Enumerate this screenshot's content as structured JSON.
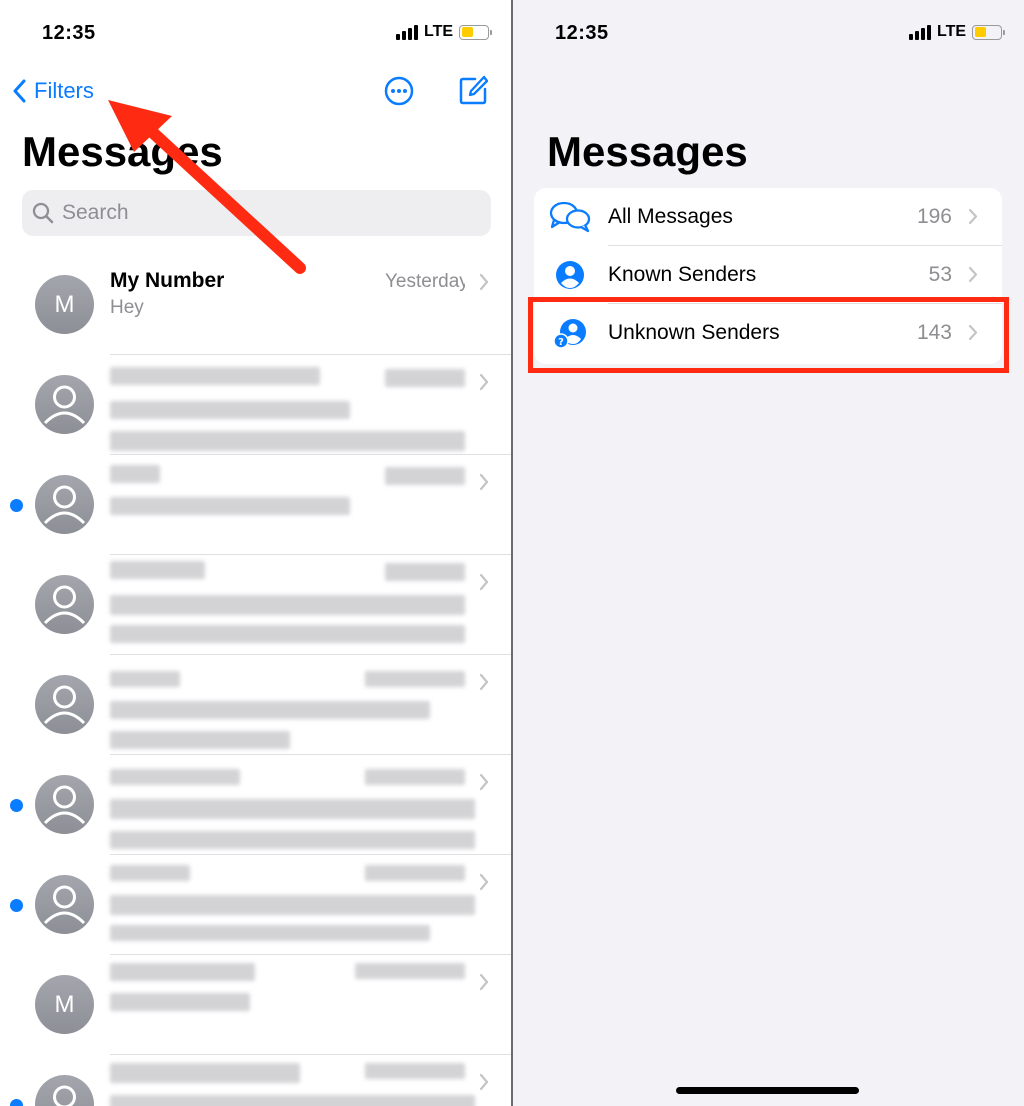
{
  "left": {
    "status": {
      "time": "12:35",
      "network": "LTE"
    },
    "nav": {
      "back_label": "Filters"
    },
    "title": "Messages",
    "search": {
      "placeholder": "Search"
    },
    "messages": [
      {
        "avatar": "M",
        "name": "My Number",
        "preview": "Hey",
        "time": "Yesterday",
        "unread": false
      },
      {
        "avatar": "",
        "name": "",
        "preview": "",
        "time": "",
        "unread": false
      },
      {
        "avatar": "",
        "name": "",
        "preview": "",
        "time": "",
        "unread": true
      },
      {
        "avatar": "",
        "name": "",
        "preview": "",
        "time": "",
        "unread": false
      },
      {
        "avatar": "",
        "name": "",
        "preview": "",
        "time": "",
        "unread": false
      },
      {
        "avatar": "",
        "name": "",
        "preview": "",
        "time": "",
        "unread": true
      },
      {
        "avatar": "",
        "name": "",
        "preview": "",
        "time": "",
        "unread": true
      },
      {
        "avatar": "M",
        "name": "",
        "preview": "",
        "time": "",
        "unread": false
      },
      {
        "avatar": "",
        "name": "",
        "preview": "",
        "time": "",
        "unread": true
      }
    ]
  },
  "right": {
    "status": {
      "time": "12:35",
      "network": "LTE"
    },
    "title": "Messages",
    "filters": [
      {
        "icon": "chat-bubbles-icon",
        "label": "All Messages",
        "count": "196"
      },
      {
        "icon": "person-circle-icon",
        "label": "Known Senders",
        "count": "53"
      },
      {
        "icon": "person-question-icon",
        "label": "Unknown Senders",
        "count": "143"
      }
    ]
  },
  "colors": {
    "accent": "#0a7cff",
    "annotation": "#ff2a12",
    "secondary_text": "#8e8e93",
    "battery": "#ffcc00"
  }
}
